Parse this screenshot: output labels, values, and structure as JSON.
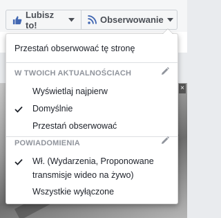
{
  "page_actions": {
    "like_label": "Lubisz to!",
    "follow_label": "Obserwowanie"
  },
  "menu": {
    "unfollow_page": "Przestań obserwować tę stronę",
    "news_feed": {
      "title": "W TWOICH AKTUALNOŚCIACH",
      "items": [
        {
          "label": "Wyświetlaj najpierw",
          "checked": false
        },
        {
          "label": "Domyślnie",
          "checked": true
        },
        {
          "label": "Przestań obserwować",
          "checked": false
        }
      ]
    },
    "notifications": {
      "title": "POWIADOMIENIA",
      "items": [
        {
          "label_line1": "Wł. (Wydarzenia, Proponowane",
          "label_line2": "transmisje wideo na żywo)",
          "checked": true
        },
        {
          "label": "Wszystkie wyłączone",
          "checked": false
        }
      ]
    }
  },
  "colors": {
    "accent": "#4267b2",
    "section_title": "#90949c",
    "text": "#1d2129"
  }
}
